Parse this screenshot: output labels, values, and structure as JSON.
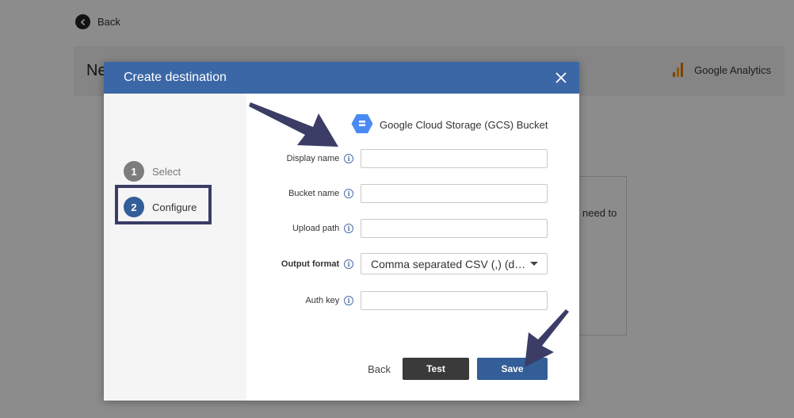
{
  "background": {
    "back_label": "Back",
    "title_partial": "Ne",
    "source_name": "Google Analytics",
    "card_text": "need to"
  },
  "modal": {
    "title": "Create destination",
    "close_icon": "close-icon"
  },
  "steps": [
    {
      "number": "1",
      "label": "Select",
      "state": "completed"
    },
    {
      "number": "2",
      "label": "Configure",
      "state": "active"
    }
  ],
  "destination": {
    "name": "Google Cloud Storage (GCS) Bucket",
    "icon": "gcs-hexagon-icon"
  },
  "form": {
    "display_name": {
      "label": "Display name",
      "value": ""
    },
    "bucket_name": {
      "label": "Bucket name",
      "value": ""
    },
    "upload_path": {
      "label": "Upload path",
      "value": ""
    },
    "output_format": {
      "label": "Output format",
      "value": "Comma separated CSV (,) (def..."
    },
    "auth_key": {
      "label": "Auth key",
      "value": ""
    }
  },
  "buttons": {
    "back": "Back",
    "test": "Test",
    "save": "Save"
  },
  "colors": {
    "header": "#3c67a6",
    "primary": "#335e97",
    "dark_button": "#3a3a3a",
    "annotation": "#3b3d66"
  }
}
